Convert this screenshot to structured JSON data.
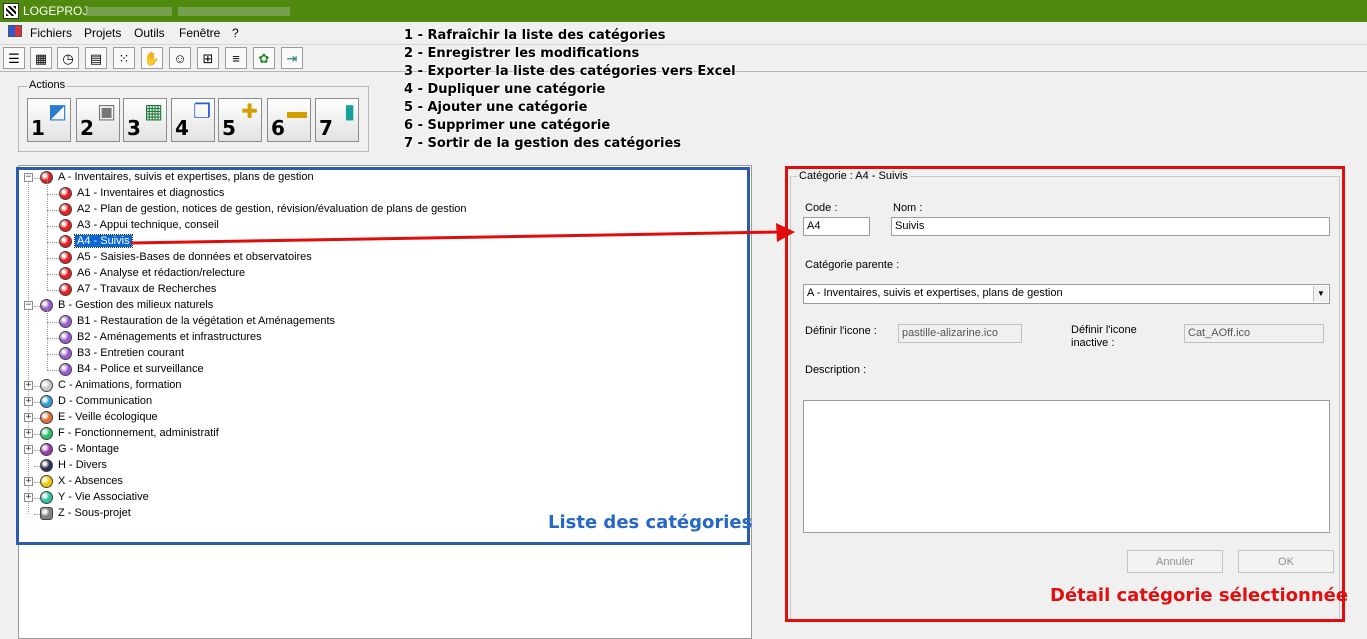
{
  "titlebar": {
    "title": "LOGEPROJ"
  },
  "menu": [
    "Fichiers",
    "Projets",
    "Outils",
    "Fenêtre",
    "?"
  ],
  "toolbar_icons": [
    "list-icon",
    "calendar-icon",
    "clock-icon",
    "document-icon",
    "network-icon",
    "handshake-icon",
    "people-icon",
    "hierarchy-icon",
    "tasks-icon",
    "frog-icon",
    "exit-icon"
  ],
  "actions": {
    "legend": "Actions",
    "buttons": [
      {
        "num": "1",
        "icon": "refresh-icon"
      },
      {
        "num": "2",
        "icon": "save-icon"
      },
      {
        "num": "3",
        "icon": "excel-icon"
      },
      {
        "num": "4",
        "icon": "duplicate-icon"
      },
      {
        "num": "5",
        "icon": "add-icon"
      },
      {
        "num": "6",
        "icon": "delete-icon"
      },
      {
        "num": "7",
        "icon": "exit-door-icon"
      }
    ]
  },
  "annotations": [
    "1 - Rafraîchir la liste des catégories",
    "2 - Enregistrer les modifications",
    "3 - Exporter la liste des catégories vers Excel",
    "4 - Dupliquer une catégorie",
    "5 - Ajouter une catégorie",
    "6 - Supprimer une catégorie",
    "7 - Sortir de la gestion des catégories"
  ],
  "tree": [
    {
      "label": "A - Inventaires, suivis et expertises, plans de gestion",
      "color": "#e02020",
      "level": 0,
      "expander": "-"
    },
    {
      "label": "A1 - Inventaires et diagnostics",
      "color": "#e02020",
      "level": 1
    },
    {
      "label": "A2 - Plan de gestion, notices de gestion, révision/évaluation de plans de gestion",
      "color": "#e02020",
      "level": 1
    },
    {
      "label": "A3 - Appui technique, conseil",
      "color": "#e02020",
      "level": 1
    },
    {
      "label": "A4 - Suivis",
      "color": "#e02020",
      "level": 1,
      "selected": true
    },
    {
      "label": "A5 - Saisies-Bases de données et observatoires",
      "color": "#e02020",
      "level": 1
    },
    {
      "label": "A6 - Analyse et rédaction/relecture",
      "color": "#e02020",
      "level": 1
    },
    {
      "label": "A7 - Travaux de Recherches",
      "color": "#e02020",
      "level": 1
    },
    {
      "label": "B - Gestion des milieux naturels",
      "color": "#9b59d0",
      "level": 0,
      "expander": "-"
    },
    {
      "label": "B1 - Restauration de la végétation et Aménagements",
      "color": "#9b59d0",
      "level": 1
    },
    {
      "label": "B2 - Aménagements et infrastructures",
      "color": "#9b59d0",
      "level": 1
    },
    {
      "label": "B3 - Entretien courant",
      "color": "#9b59d0",
      "level": 1
    },
    {
      "label": "B4 - Police et surveillance",
      "color": "#9b59d0",
      "level": 1
    },
    {
      "label": "C - Animations, formation",
      "color": "#c8c8c8",
      "level": 0,
      "expander": "+"
    },
    {
      "label": "D - Communication",
      "color": "#2e9ad8",
      "level": 0,
      "expander": "+"
    },
    {
      "label": "E - Veille écologique",
      "color": "#e07030",
      "level": 0,
      "expander": "+"
    },
    {
      "label": "F - Fonctionnement, administratif",
      "color": "#28c060",
      "level": 0,
      "expander": "+"
    },
    {
      "label": "G - Montage",
      "color": "#9a3ab0",
      "level": 0,
      "expander": "+"
    },
    {
      "label": "H - Divers",
      "color": "#30305a",
      "level": 0
    },
    {
      "label": "X - Absences",
      "color": "#f0c800",
      "level": 0,
      "expander": "+"
    },
    {
      "label": "Y - Vie Associative",
      "color": "#30c0a0",
      "level": 0,
      "expander": "+"
    },
    {
      "label": "Z - Sous-projet",
      "color": "#808080",
      "level": 0,
      "square": true
    }
  ],
  "list_caption": "Liste des catégories",
  "detail": {
    "legend": "Catégorie : A4 - Suivis",
    "code_label": "Code :",
    "code_value": "A4",
    "nom_label": "Nom :",
    "nom_value": "Suivis",
    "parent_label": "Catégorie parente :",
    "parent_value": "A - Inventaires, suivis et expertises, plans de gestion",
    "icon_label": "Définir l'icone :",
    "icon_value": "pastille-alizarine.ico",
    "icon_inactive_label_1": "Définir l'icone",
    "icon_inactive_label_2": "inactive :",
    "icon_inactive_value": "Cat_AOff.ico",
    "description_label": "Description :",
    "description_value": "",
    "cancel_label": "Annuler",
    "ok_label": "OK"
  },
  "detail_caption": "Détail catégorie sélectionnée",
  "colors": {
    "titlebar": "#4f8a0f",
    "list_highlight": "#2a5cab",
    "detail_highlight": "#e00d0d",
    "selection": "#0a67d8"
  }
}
